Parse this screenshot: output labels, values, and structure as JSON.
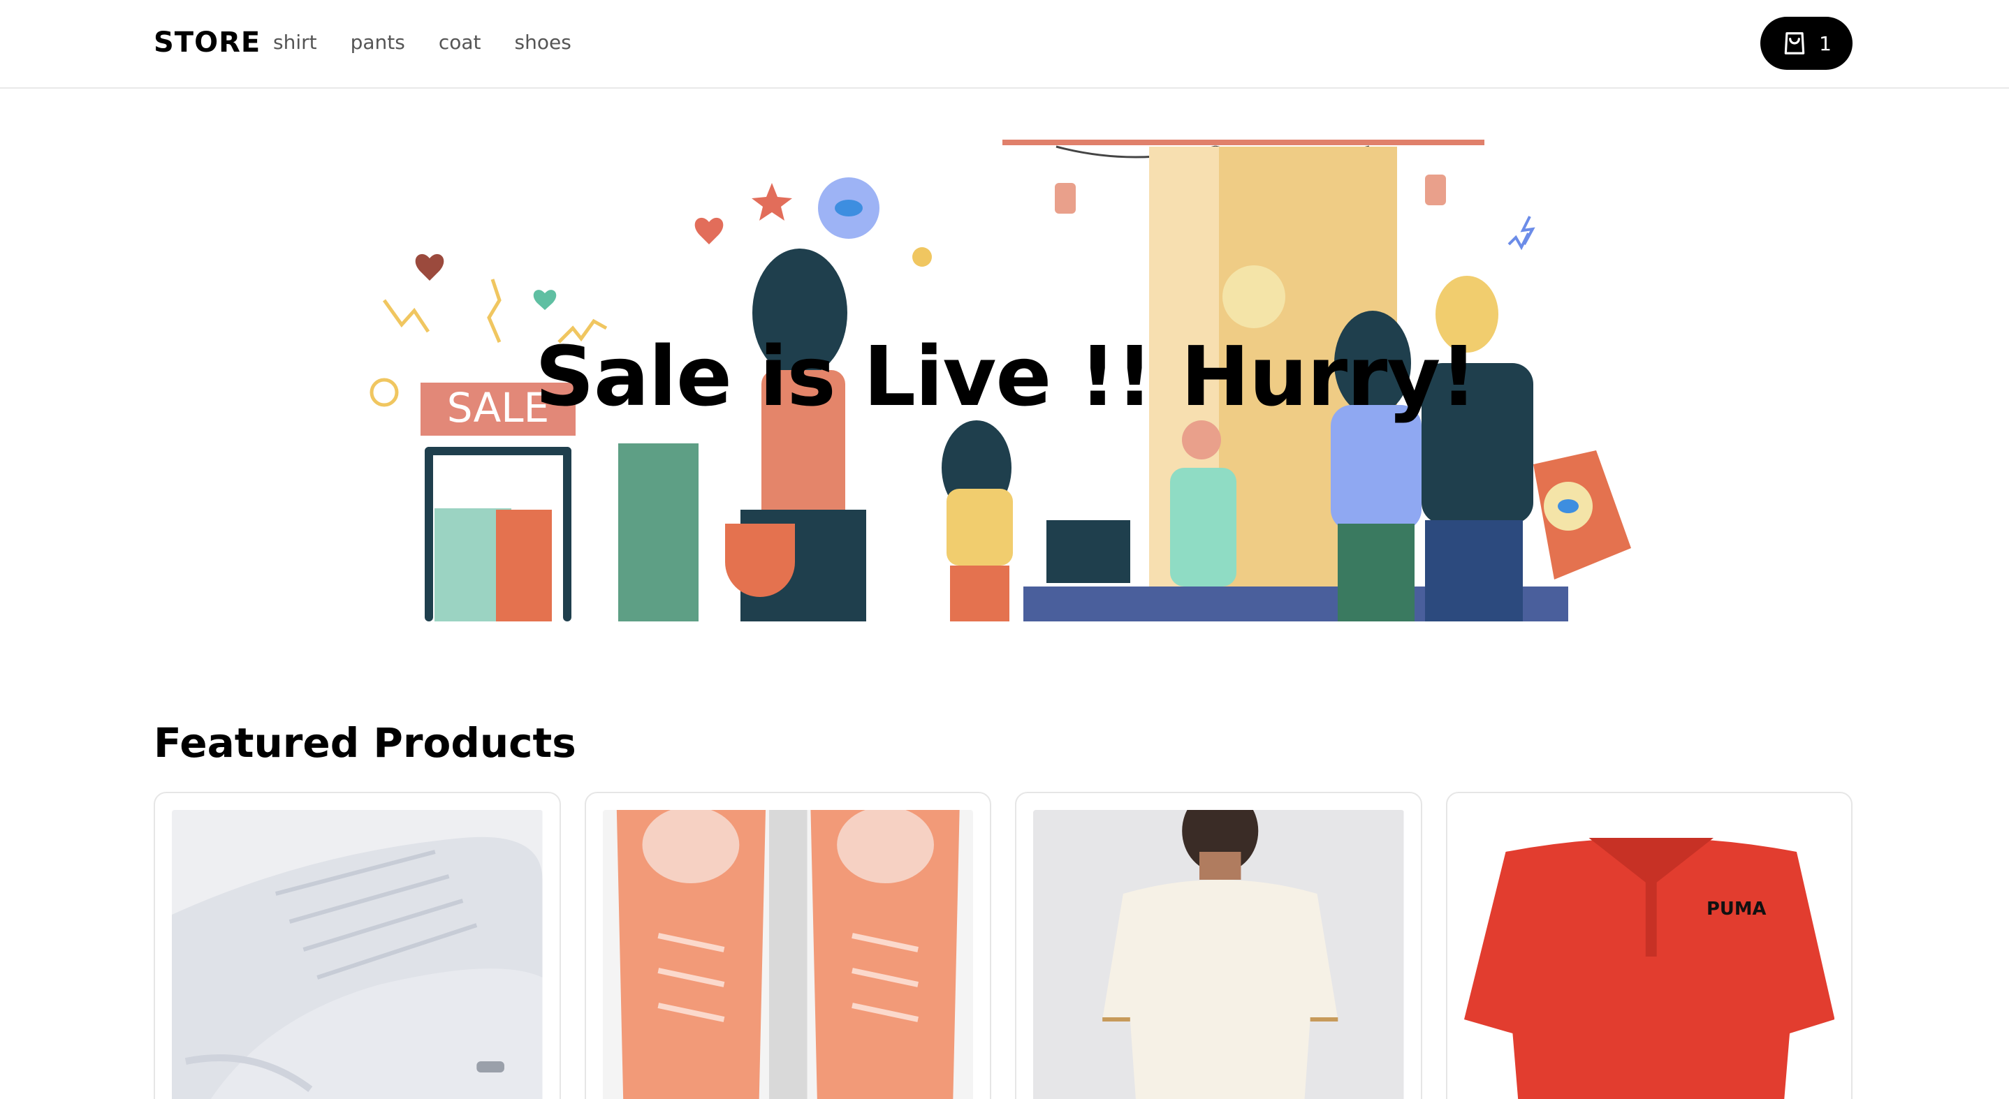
{
  "header": {
    "logo": "STORE",
    "nav": [
      "shirt",
      "pants",
      "coat",
      "shoes"
    ],
    "cart_count": "1",
    "cart_icon": "shopping-bag-icon"
  },
  "hero": {
    "title": "Sale is Live !! Hurry!",
    "sign_text": "SALE"
  },
  "featured": {
    "title": "Featured Products",
    "products": [
      {
        "image": "white-sneaker"
      },
      {
        "image": "orange-sneakers"
      },
      {
        "image": "cream-polo-back"
      },
      {
        "image": "red-puma-polo",
        "brand_text": "PUMA"
      }
    ]
  },
  "colors": {
    "accent": "#000000",
    "sale_sign": "#e28878",
    "teal": "#1f3f4d"
  }
}
